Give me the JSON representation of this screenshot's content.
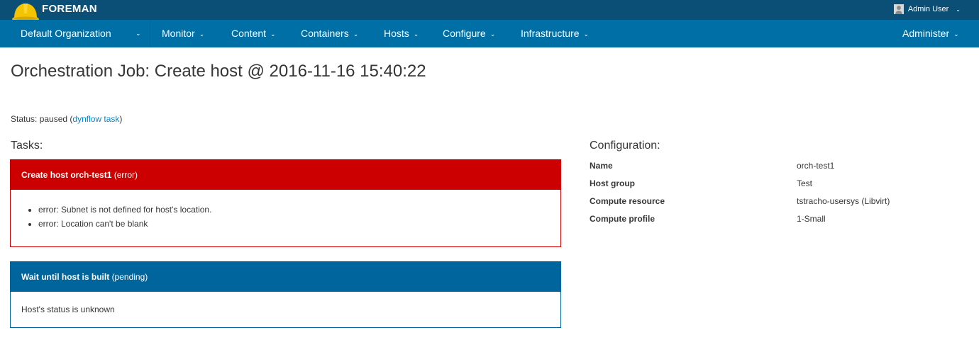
{
  "header": {
    "brand": "FOREMAN",
    "user": "Admin User"
  },
  "nav": {
    "organization": "Default Organization",
    "items": [
      {
        "label": "Monitor"
      },
      {
        "label": "Content"
      },
      {
        "label": "Containers"
      },
      {
        "label": "Hosts"
      },
      {
        "label": "Configure"
      },
      {
        "label": "Infrastructure"
      }
    ],
    "administer": "Administer"
  },
  "page": {
    "title": "Orchestration Job: Create host @ 2016-11-16 15:40:22",
    "status_prefix": "Status: paused (",
    "status_link": "dynflow task",
    "status_suffix": ")"
  },
  "tasks": {
    "heading": "Tasks:",
    "items": [
      {
        "name": "Create host orch-test1",
        "state": "(error)",
        "messages": [
          "error: Subnet is not defined for host's location.",
          "error: Location can't be blank"
        ]
      },
      {
        "name": "Wait until host is built",
        "state": "(pending)",
        "body": "Host's status is unknown"
      }
    ]
  },
  "configuration": {
    "heading": "Configuration:",
    "rows": [
      {
        "key": "Name",
        "value": "orch-test1"
      },
      {
        "key": "Host group",
        "value": "Test"
      },
      {
        "key": "Compute resource",
        "value": "tstracho-usersys (Libvirt)"
      },
      {
        "key": "Compute profile",
        "value": "1-Small"
      }
    ]
  },
  "colors": {
    "topbar": "#0b4f77",
    "navbar": "#006fa5",
    "error": "#cc0000",
    "pending": "#00659c",
    "link": "#0088ce"
  }
}
